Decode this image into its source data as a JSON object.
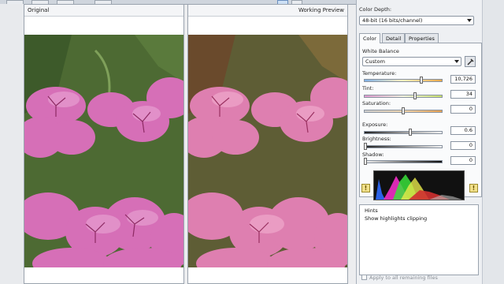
{
  "preview": {
    "original_title": "Original",
    "working_title": "Working Preview"
  },
  "panel": {
    "color_depth_label": "Color Depth:",
    "color_depth_value": "48-bit (16 bits/channel)",
    "tabs": [
      {
        "label": "Color",
        "active": true
      },
      {
        "label": "Detail",
        "active": false
      },
      {
        "label": "Properties",
        "active": false
      }
    ],
    "white_balance_label": "White Balance",
    "white_balance_value": "Custom",
    "temperature": {
      "label": "Temperature:",
      "value": "10,726",
      "level": 0.74
    },
    "tint": {
      "label": "Tint:",
      "value": "34",
      "level": 0.66
    },
    "saturation": {
      "label": "Saturation:",
      "value": "0",
      "level": 0.5
    },
    "exposure": {
      "label": "Exposure:",
      "value": "0.6",
      "level": 0.59
    },
    "brightness": {
      "label": "Brightness:",
      "value": "0",
      "level": 0.0
    },
    "shadow": {
      "label": "Shadow:",
      "value": "0",
      "level": 0.0
    },
    "hints_title": "Hints",
    "hints_item": "Show highlights clipping",
    "apply_all_label": "Apply to all remaining files"
  },
  "colors": {
    "accent": "#3a6fb0",
    "flower": "#d86fb8",
    "leaf": "#4f6e34"
  }
}
